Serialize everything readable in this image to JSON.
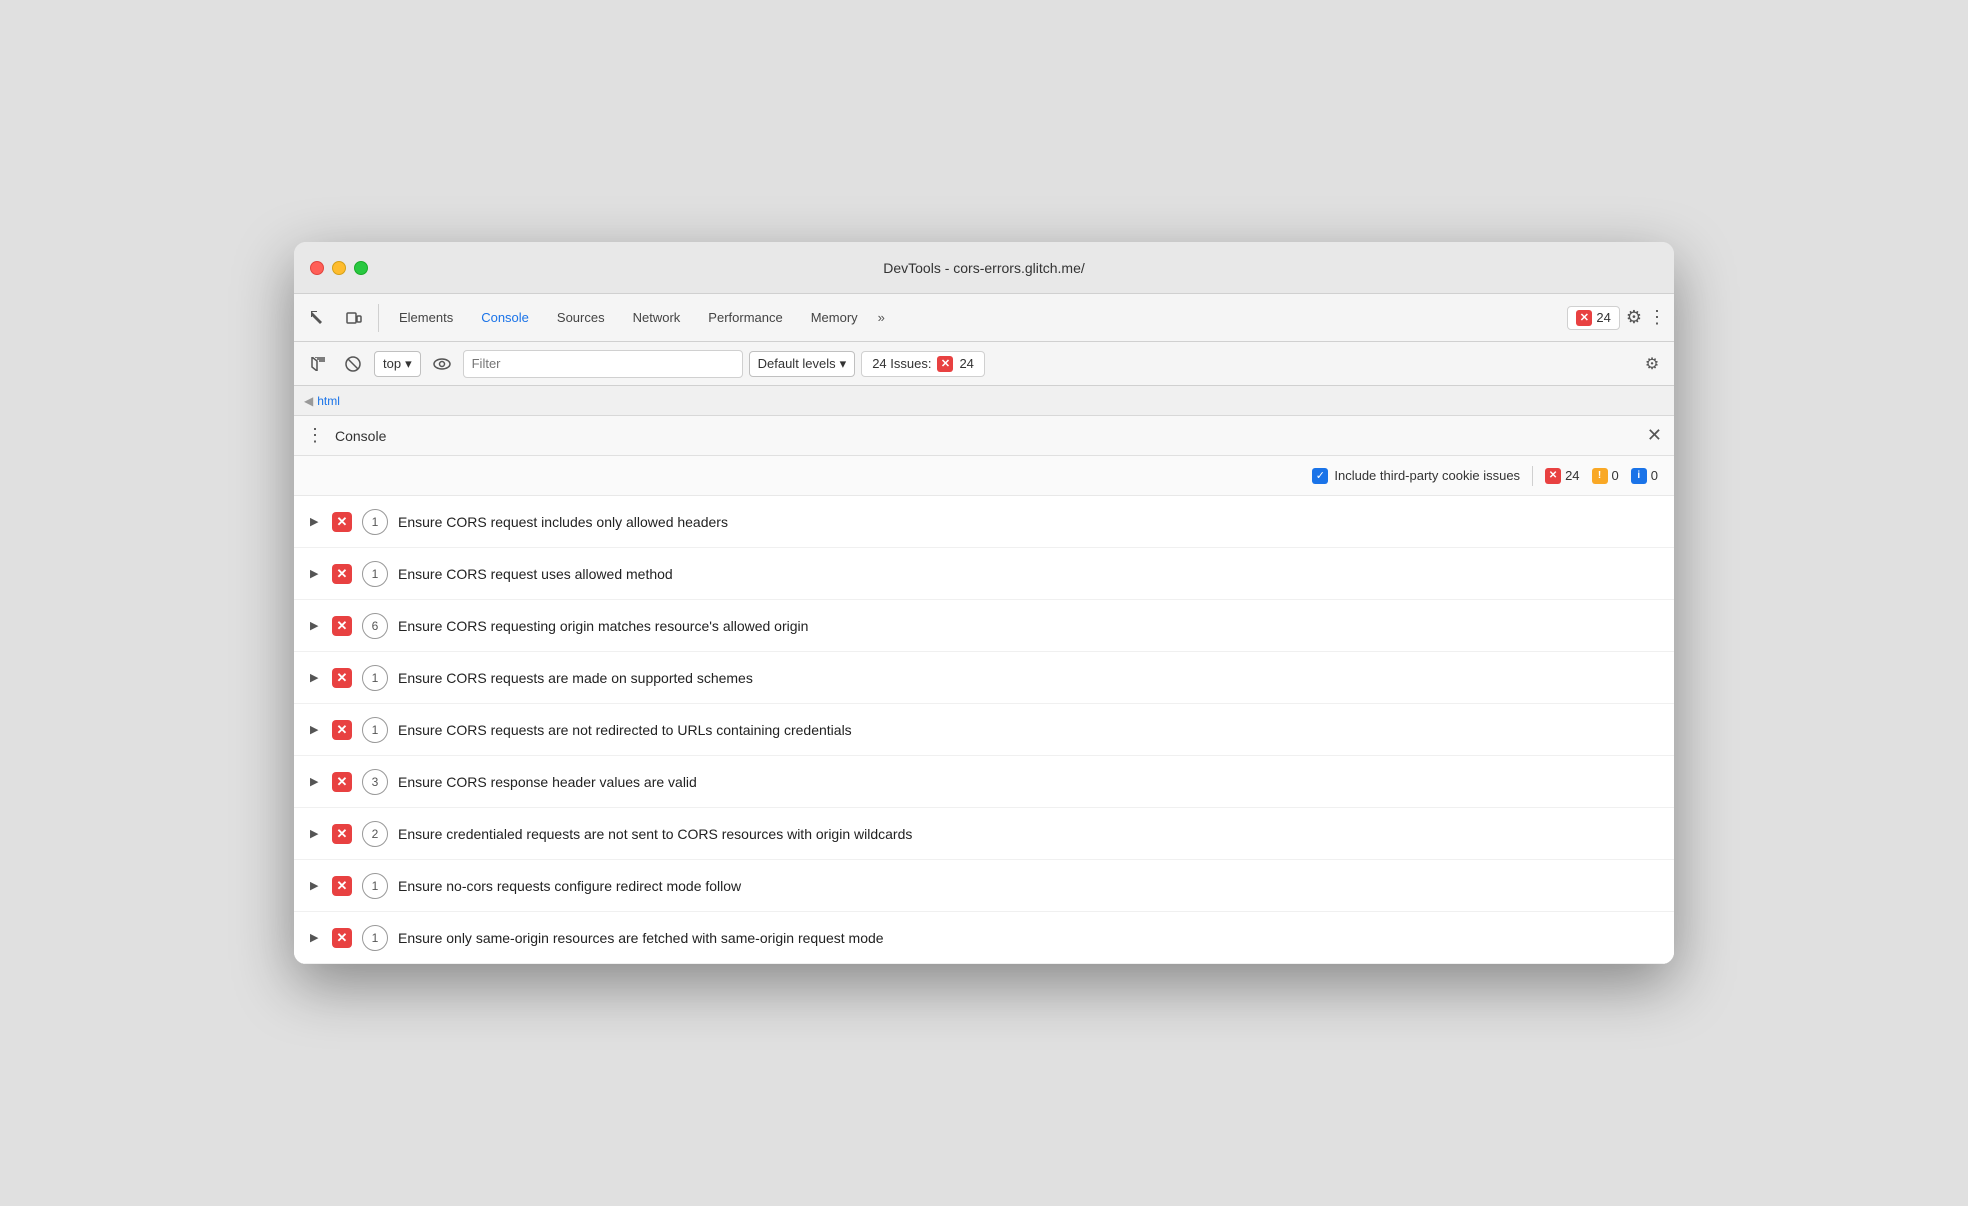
{
  "window": {
    "title": "DevTools - cors-errors.glitch.me/"
  },
  "toolbar": {
    "tabs": [
      {
        "id": "elements",
        "label": "Elements",
        "active": false
      },
      {
        "id": "console",
        "label": "Console",
        "active": true
      },
      {
        "id": "sources",
        "label": "Sources",
        "active": false
      },
      {
        "id": "network",
        "label": "Network",
        "active": false
      },
      {
        "id": "performance",
        "label": "Performance",
        "active": false
      },
      {
        "id": "memory",
        "label": "Memory",
        "active": false
      }
    ],
    "more_tabs": "»",
    "error_count": "24",
    "error_icon": "✕"
  },
  "console_toolbar": {
    "top_label": "top",
    "filter_placeholder": "Filter",
    "default_levels_label": "Default levels",
    "issues_label": "24 Issues:",
    "issues_count": "24"
  },
  "breadcrumb": {
    "arrow": "◀",
    "html": "html"
  },
  "console_panel": {
    "header_label": "Console",
    "close_icon": "✕",
    "include_cookie_label": "Include third-party cookie issues",
    "error_count": "24",
    "warning_count": "0",
    "info_count": "0"
  },
  "issues": [
    {
      "count": 1,
      "text": "Ensure CORS request includes only allowed headers"
    },
    {
      "count": 1,
      "text": "Ensure CORS request uses allowed method"
    },
    {
      "count": 6,
      "text": "Ensure CORS requesting origin matches resource's allowed origin"
    },
    {
      "count": 1,
      "text": "Ensure CORS requests are made on supported schemes"
    },
    {
      "count": 1,
      "text": "Ensure CORS requests are not redirected to URLs containing credentials"
    },
    {
      "count": 3,
      "text": "Ensure CORS response header values are valid"
    },
    {
      "count": 2,
      "text": "Ensure credentialed requests are not sent to CORS resources with origin wildcards"
    },
    {
      "count": 1,
      "text": "Ensure no-cors requests configure redirect mode follow"
    },
    {
      "count": 1,
      "text": "Ensure only same-origin resources are fetched with same-origin request mode"
    }
  ]
}
